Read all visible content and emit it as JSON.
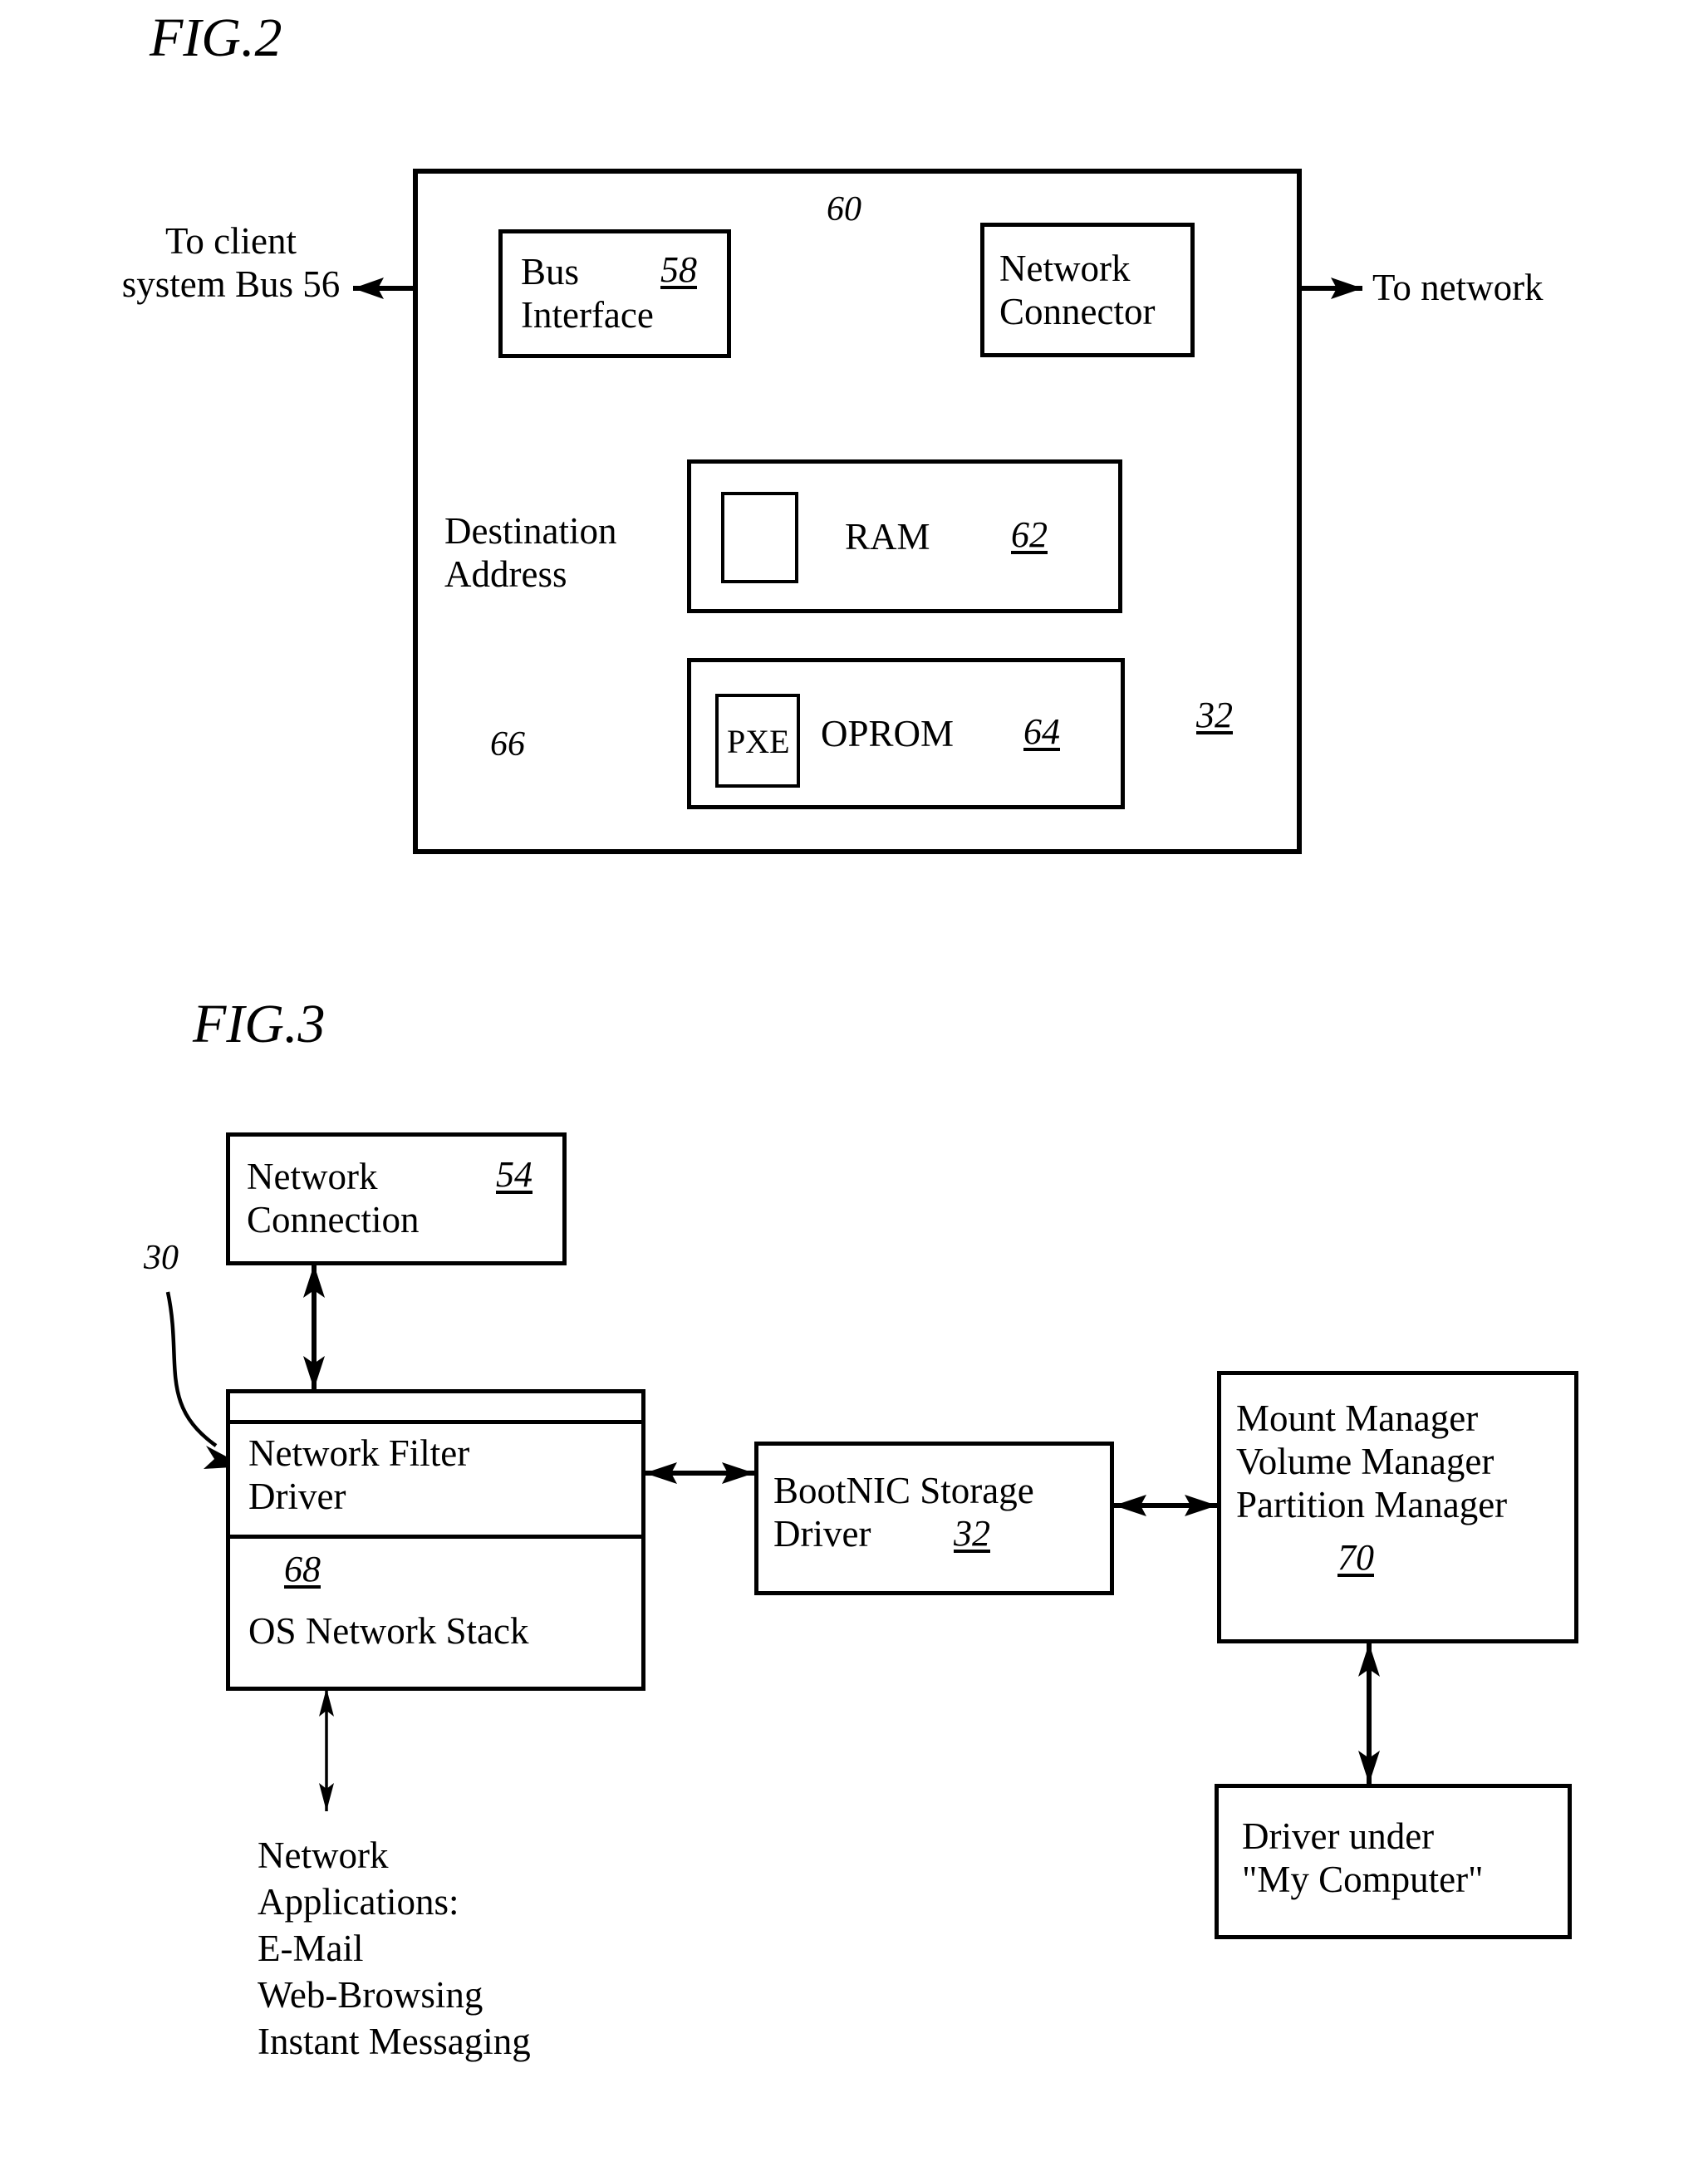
{
  "figures": [
    {
      "title": "FIG.2",
      "ref_outer": "32",
      "boxes": {
        "bus_interface": {
          "label": "Bus\nInterface",
          "ref": "58"
        },
        "network_connector": {
          "label": "Network\nConnector",
          "ref": "60"
        },
        "ram": {
          "label": "RAM",
          "ref": "62",
          "inner_label": ""
        },
        "oprom": {
          "label": "OPROM",
          "ref": "64",
          "inner_label": "PXE"
        }
      },
      "labels": {
        "to_client_bus": "To client\nsystem Bus 56",
        "to_network": "To network",
        "destination_address": "Destination\nAddress",
        "pxe_leader": "66",
        "connector_leader": "60"
      }
    },
    {
      "title": "FIG.3",
      "ref_diagram": "30",
      "boxes": {
        "network_connection": {
          "label": "Network\nConnection",
          "ref": "54"
        },
        "network_filter_driver": {
          "label": "Network Filter\nDriver"
        },
        "os_network_stack": {
          "label": "OS Network Stack",
          "ref": "68"
        },
        "bootnic_storage_driver": {
          "label": "BootNIC Storage\nDriver",
          "ref": "32"
        },
        "managers": {
          "label": "Mount Manager\nVolume Manager\nPartition Manager",
          "ref": "70"
        },
        "driver_my_computer": {
          "label": "Driver under\n\"My Computer\""
        }
      },
      "labels": {
        "network_applications": "Network\nApplications:\nE-Mail\nWeb-Browsing\nInstant Messaging"
      }
    }
  ],
  "colors": {
    "ink": "#000000",
    "paper": "#ffffff"
  }
}
